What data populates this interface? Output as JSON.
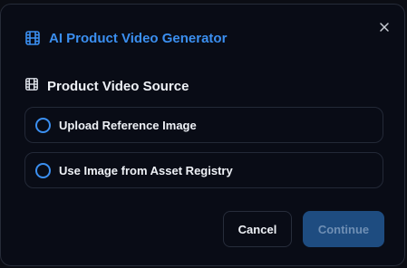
{
  "dialog": {
    "title": "AI Product Video Generator",
    "title_icon": "film-icon",
    "close_icon": "close-icon"
  },
  "section": {
    "title": "Product Video Source",
    "icon": "film-icon"
  },
  "options": [
    {
      "label": "Upload Reference Image",
      "selected": false
    },
    {
      "label": "Use Image from Asset Registry",
      "selected": false
    }
  ],
  "actions": {
    "cancel_label": "Cancel",
    "continue_label": "Continue",
    "continue_disabled": true
  },
  "colors": {
    "accent": "#3b8ff0",
    "background": "#090c16",
    "border": "#232937",
    "primary_button_disabled": "#1e4c80"
  }
}
